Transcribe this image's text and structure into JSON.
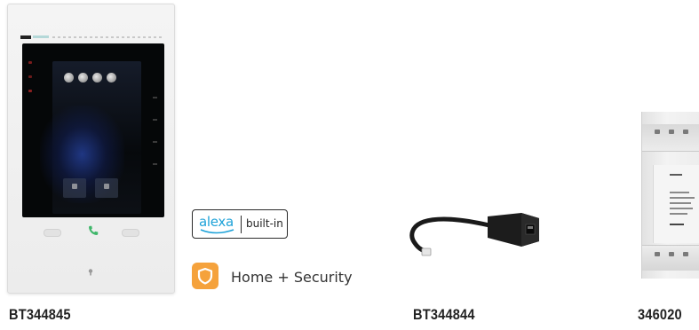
{
  "products": [
    {
      "sku": "BT344845"
    },
    {
      "sku": "BT344844"
    },
    {
      "sku": "346020"
    }
  ],
  "badges": {
    "alexa_word": "alexa",
    "alexa_built_in": "built-in",
    "security_icon": "shield-icon",
    "security_label": "Home + Security"
  },
  "colors": {
    "alexa_blue": "#1ea2d8",
    "security_orange": "#f5a23c",
    "sku_text": "#222222"
  }
}
